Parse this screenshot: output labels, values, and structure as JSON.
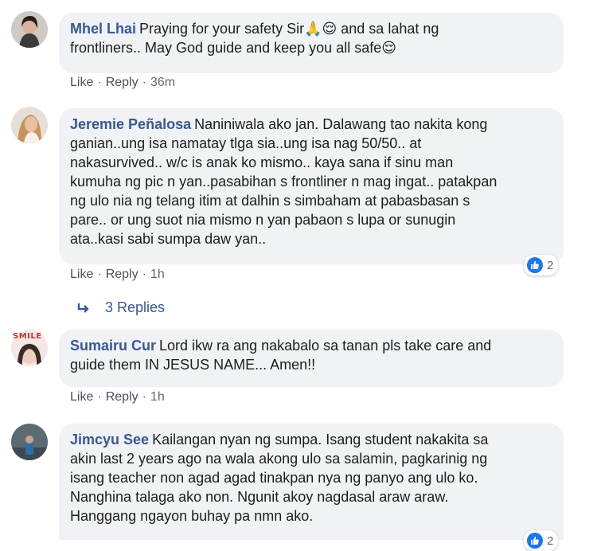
{
  "comments": [
    {
      "author": "Mhel Lhai",
      "text": "Praying for your safety Sir🙏😌 and sa lahat ng\nfrontliners.. May God guide and keep you all safe😌",
      "like": "Like",
      "reply": "Reply",
      "time": "36m",
      "avatar_icon": "profile-photo"
    },
    {
      "author": "Jeremie Peñalosa",
      "text": "Naniniwala ako jan. Dalawang tao nakita kong\nganian..ung isa namatay tlga sia..ung isa nag 50/50.. at\nnakasurvived.. w/c is anak ko mismo.. kaya sana if sinu man\nkumuha ng pic n yan..pasabihan s frontliner n mag ingat.. patakpan\nng ulo nia ng telang itim at dalhin s simbaham at pabasbasan s\npare.. or ung suot nia mismo n yan pabaon s lupa or sunugin\nata..kasi sabi sumpa daw yan..",
      "like": "Like",
      "reply": "Reply",
      "time": "1h",
      "reaction_count": "2",
      "replies_label": "3 Replies",
      "avatar_icon": "profile-photo"
    },
    {
      "author": "Sumairu Cur",
      "text": "Lord ikw ra ang nakabalo sa tanan pls take care and\nguide them IN JESUS NAME... Amen!!",
      "like": "Like",
      "reply": "Reply",
      "time": "1h",
      "avatar_badge": "SMILE",
      "avatar_icon": "profile-photo"
    },
    {
      "author": "Jimcyu See",
      "text": "Kailangan nyan ng sumpa. Isang student nakakita sa\nakin last 2 years ago na wala akong ulo sa salamin, pagkarinig ng\nisang teacher non agad agad tinakpan nya ng panyo ang ulo ko.\nNanghina talaga ako non. Ngunit akoy nagdasal araw araw.\nHanggang ngayon buhay pa nmn ako.",
      "reaction_count": "2",
      "avatar_icon": "profile-photo"
    }
  ],
  "colors": {
    "author": "#385898",
    "bubble": "#f0f2f5",
    "meta": "#65676b",
    "like_blue": "#1877f2"
  }
}
